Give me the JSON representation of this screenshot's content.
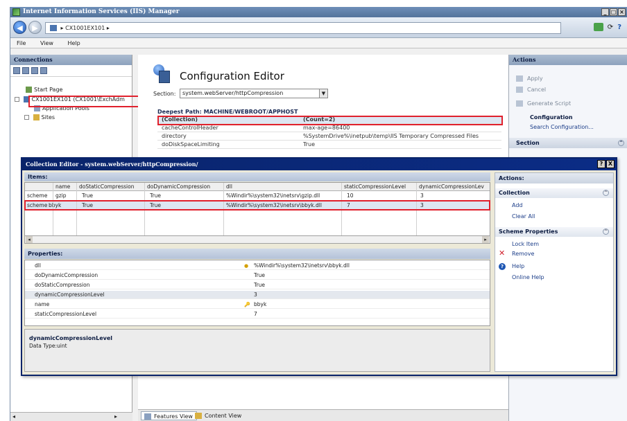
{
  "window": {
    "title": "Internet Information Services (IIS) Manager",
    "buttons": [
      "_",
      "□",
      "×"
    ]
  },
  "address": {
    "path": "CX1001EX101",
    "arrow": "▸"
  },
  "menu": [
    "File",
    "View",
    "Help"
  ],
  "connections": {
    "header": "Connections",
    "tree": [
      "Start Page",
      "CX1001EX101 (CX1001\\ExchAdm",
      "Application Pools",
      "Sites"
    ]
  },
  "config_editor": {
    "title": "Configuration Editor",
    "section_label": "Section:",
    "section_value": "system.webServer/httpCompression",
    "deepest_path": "Deepest Path: MACHINE/WEBROOT/APPHOST",
    "rows": [
      {
        "key": "(Collection)",
        "value": "(Count=2)"
      },
      {
        "key": "cacheControlHeader",
        "value": "max-age=86400"
      },
      {
        "key": "directory",
        "value": "%SystemDrive%\\inetpub\\temp\\IIS Temporary Compressed Files"
      },
      {
        "key": "doDiskSpaceLimiting",
        "value": "True"
      }
    ]
  },
  "actions": {
    "header": "Actions",
    "apply": "Apply",
    "cancel": "Cancel",
    "generate_script": "Generate Script",
    "configuration": "Configuration",
    "search_configuration": "Search Configuration...",
    "section": "Section"
  },
  "bottom_tabs": {
    "features_view": "Features View",
    "content_view": "Content View"
  },
  "dialog": {
    "title": "Collection Editor - system.webServer/httpCompression/",
    "help_button": "?",
    "close_button": "X",
    "items_header": "Items:",
    "columns": [
      "name",
      "doStaticCompression",
      "doDynamicCompression",
      "dll",
      "staticCompressionLevel",
      "dynamicCompressionLev"
    ],
    "rows": [
      {
        "kind": "scheme",
        "name": "gzip",
        "static": "True",
        "dynamic": "True",
        "dll": "%Windir%\\system32\\inetsrv\\gzip.dll",
        "slevel": "10",
        "dlevel": "3"
      },
      {
        "kind": "scheme",
        "name": "bbyk",
        "static": "True",
        "dynamic": "True",
        "dll": "%Windir%\\system32\\inetsrv\\bbyk.dll",
        "slevel": "7",
        "dlevel": "3"
      }
    ],
    "scroll_left": "◂",
    "scroll_right": "▸",
    "properties_header": "Properties:",
    "properties": [
      {
        "key": "dll",
        "value": "%Windir%\\system32\\inetsrv\\bbyk.dll",
        "marker": "●"
      },
      {
        "key": "doDynamicCompression",
        "value": "True",
        "marker": ""
      },
      {
        "key": "doStaticCompression",
        "value": "True",
        "marker": ""
      },
      {
        "key": "dynamicCompressionLevel",
        "value": "3",
        "marker": ""
      },
      {
        "key": "name",
        "value": "bbyk",
        "marker": "🔑"
      },
      {
        "key": "staticCompressionLevel",
        "value": "7",
        "marker": ""
      }
    ],
    "description_title": "dynamicCompressionLevel",
    "description_text": "Data Type:uint",
    "actions_header": "Actions:",
    "collection_section": "Collection",
    "add": "Add",
    "clear_all": "Clear All",
    "scheme_properties": "Scheme Properties",
    "lock_item": "Lock Item",
    "remove": "Remove",
    "help": "Help",
    "online_help": "Online Help"
  }
}
